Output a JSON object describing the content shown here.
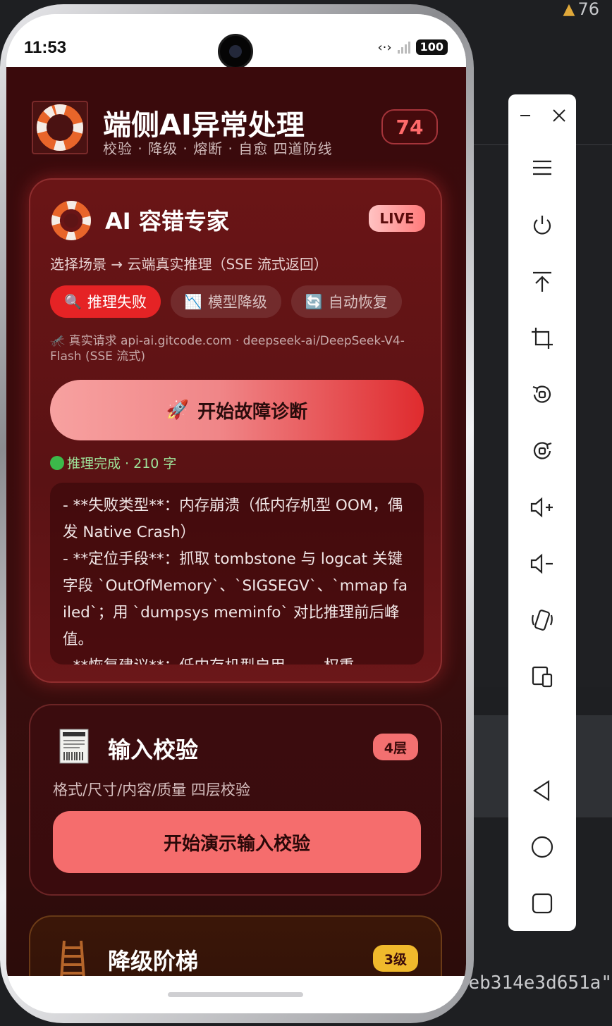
{
  "ide": {
    "warning_count": "76",
    "code_fragment": "eb314e3d651a\"",
    "warning_color": "#e0a83a"
  },
  "statusbar": {
    "time": "11:53",
    "battery": "100"
  },
  "header": {
    "title": "端侧AI异常处理",
    "subtitle": "校验 · 降级 · 熔断 · 自愈 四道防线",
    "score": "74"
  },
  "ai_card": {
    "title": "AI 容错专家",
    "live_label": "LIVE",
    "subtitle": "选择场景 → 云端真实推理（SSE 流式返回）",
    "chips": [
      {
        "icon": "🔍",
        "label": "推理失败",
        "active": true
      },
      {
        "icon": "📉",
        "label": "模型降级",
        "active": false
      },
      {
        "icon": "🔄",
        "label": "自动恢复",
        "active": false
      }
    ],
    "api_note": "🦟 真实请求 api-ai.gitcode.com · deepseek-ai/DeepSeek-V4-Flash (SSE 流式)",
    "start_button_icon": "🚀",
    "start_button_label": "开始故障诊断",
    "status": "推理完成 · 210 字",
    "output": "- **失败类型**：内存崩溃（低内存机型 OOM，偶发 Native Crash）\n- **定位手段**：抓取 tombstone 与 logcat 关键字段 `OutOfMemory`、`SIGSEGV`、`mmap failed`；用 `dumpsys meminfo` 对比推理前后峰值。\n- **恢复建议**：低内存机型启用 ...... 权重"
  },
  "input_card": {
    "title": "输入校验",
    "badge": "4层",
    "subtitle": "格式/尺寸/内容/质量 四层校验",
    "button_label": "开始演示输入校验"
  },
  "ladder_card": {
    "title": "降级阶梯",
    "badge": "3级"
  },
  "colors": {
    "accent": "#e52325",
    "background": "#3a0a0c",
    "score": "#ff6a6a",
    "success": "#9fe39a"
  },
  "toolbar": {
    "items": [
      "minimize",
      "close",
      "menu",
      "power",
      "pin-top",
      "crop",
      "rotate-left",
      "rotate-right",
      "volume-up",
      "volume-down",
      "shake",
      "multi-device",
      "back",
      "home",
      "recents"
    ]
  }
}
